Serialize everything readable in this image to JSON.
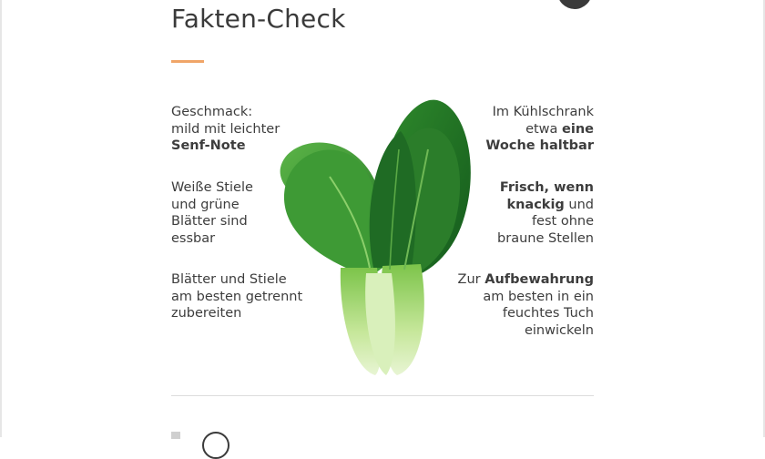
{
  "header": {
    "title": "Fakten-Check"
  },
  "colors": {
    "accent": "#f0a568",
    "text": "#3d3d3d",
    "leaf_dark": "#1f6b24",
    "leaf_mid": "#3e9a35",
    "stem": "#cfe9a8"
  },
  "facts": {
    "left": [
      {
        "l1": "Geschmack:",
        "l2": "mild mit leichter",
        "l3_bold": "Senf-Note"
      },
      {
        "l1": "Weiße Stiele",
        "l2": "und grüne",
        "l3": "Blätter sind",
        "l4": "essbar"
      },
      {
        "l1": "Blätter und Stiele",
        "l2": "am besten getrennt",
        "l3": "zubereiten"
      }
    ],
    "right": [
      {
        "l1_pre": "Im Kühlschrank",
        "l2_pre": "etwa ",
        "l2_bold": "eine",
        "l3_bold": "Woche haltbar"
      },
      {
        "l1_bold": "Frisch, wenn",
        "l2_bold": "knackig",
        "l2_post": " und",
        "l3": "fest ohne",
        "l4": "braune Stellen"
      },
      {
        "l1_pre": "Zur ",
        "l1_bold": "Aufbewahrung",
        "l2": "am besten in ein",
        "l3": "feuchtes Tuch",
        "l4": "einwickeln"
      }
    ]
  },
  "image": {
    "icon": "bok-choy-illustration"
  }
}
